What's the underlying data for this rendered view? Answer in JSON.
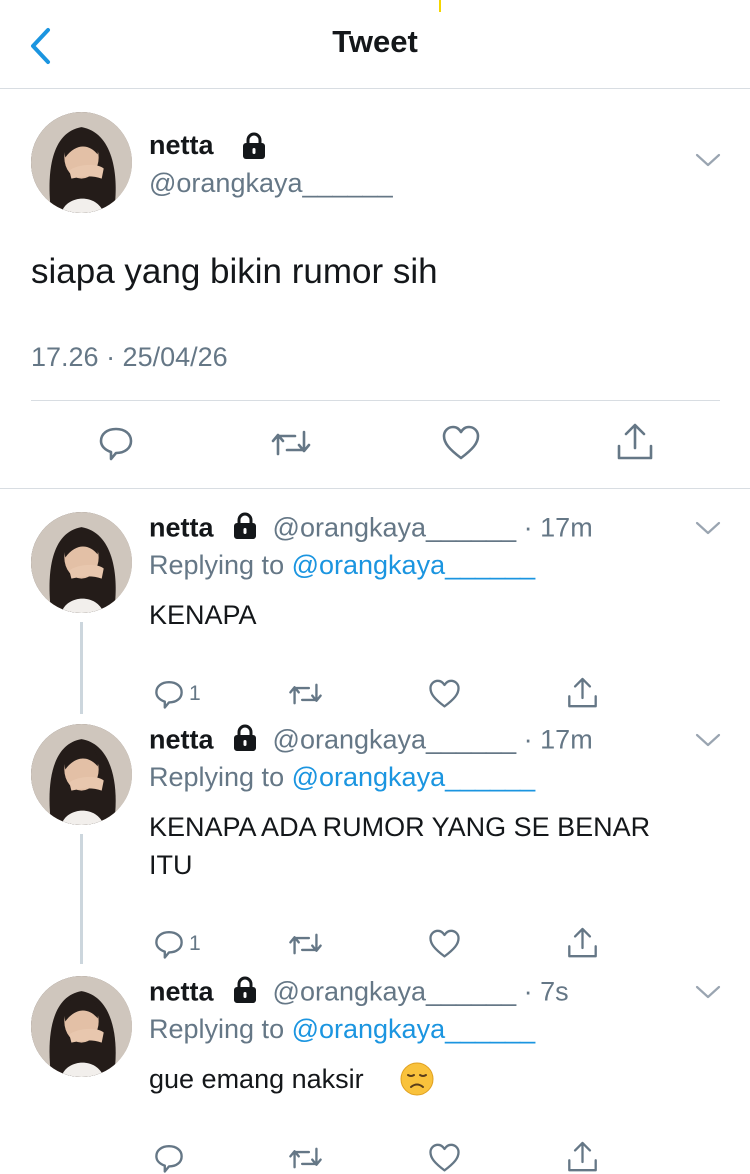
{
  "header": {
    "title": "Tweet"
  },
  "main_tweet": {
    "name": "netta",
    "handle": "@orangkaya______",
    "text": "siapa yang bikin rumor sih",
    "timestamp": "17.26 · 25/04/26"
  },
  "replies": [
    {
      "name": "netta",
      "handle": "@orangkaya______",
      "time": "17m",
      "replying_prefix": "Replying to ",
      "replying_to": "@orangkaya______",
      "text_lines": [
        "KENAPA"
      ],
      "reply_count": "1"
    },
    {
      "name": "netta",
      "handle": "@orangkaya______",
      "time": "17m",
      "replying_prefix": "Replying to ",
      "replying_to": "@orangkaya______",
      "text_lines": [
        "KENAPA ADA RUMOR YANG SE BENAR",
        "ITU"
      ],
      "reply_count": "1"
    },
    {
      "name": "netta",
      "handle": "@orangkaya______",
      "time": "7s",
      "replying_prefix": "Replying to ",
      "replying_to": "@orangkaya______",
      "text_lines": [
        "gue emang naksir"
      ],
      "emoji": "disappointed-face-emoji",
      "reply_count": ""
    }
  ],
  "icons": {
    "back": "chevron-left-icon",
    "lock": "lock-icon",
    "more": "chevron-down-icon",
    "reply": "reply-icon",
    "retweet": "retweet-icon",
    "like": "heart-icon",
    "share": "share-icon"
  },
  "colors": {
    "accent": "#1b95e0",
    "muted": "#657786",
    "text": "#14171a",
    "separator": "#d8dde2"
  }
}
